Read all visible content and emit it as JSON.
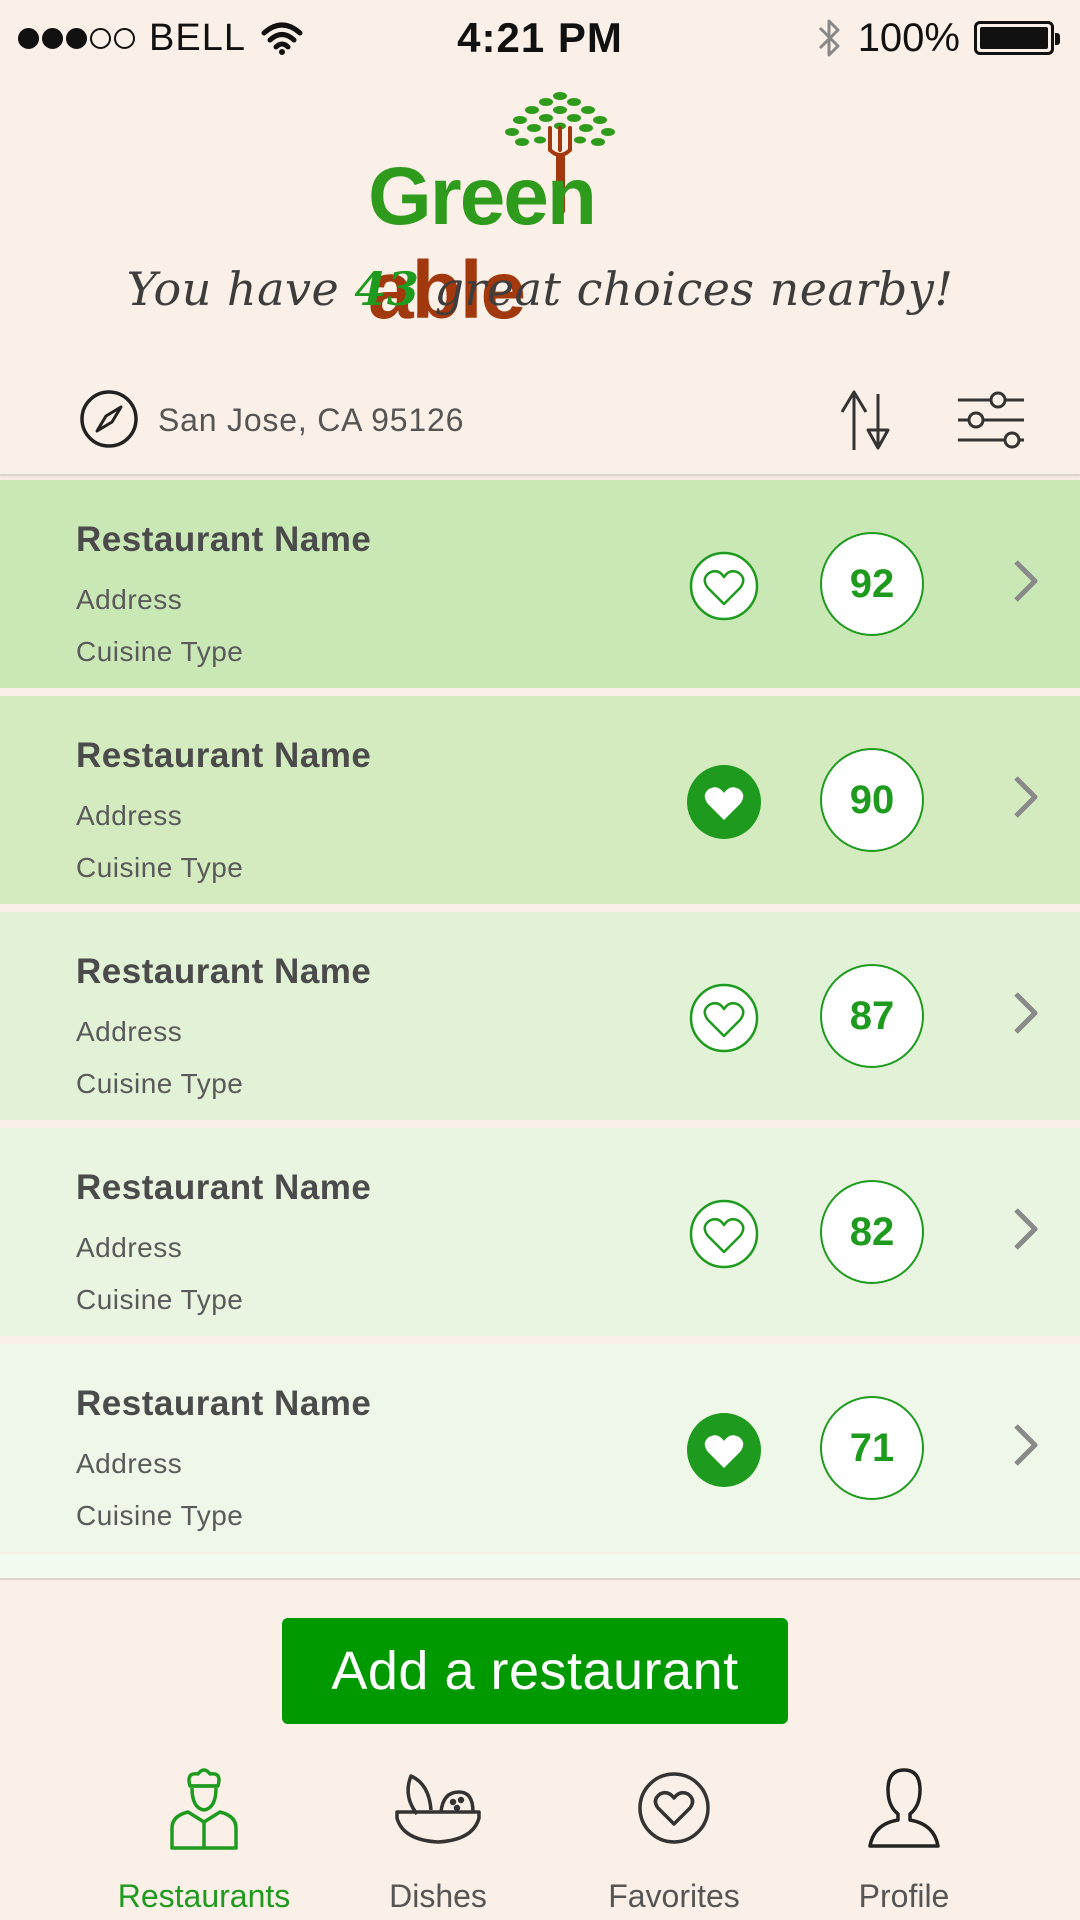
{
  "status_bar": {
    "carrier": "BELL",
    "time": "4:21 PM",
    "battery": "100%",
    "signal_bars": 3
  },
  "header": {
    "logo_part1": "Green",
    "logo_part2": "able",
    "tagline_prefix": "You have ",
    "tagline_count": "43",
    "tagline_suffix": " great choices nearby!"
  },
  "location": {
    "text": "San Jose, CA  95126"
  },
  "restaurants": [
    {
      "name": "Restaurant Name",
      "address": "Address",
      "cuisine": "Cuisine Type",
      "score": "92",
      "favorite": false,
      "bg": "#c9e8b6"
    },
    {
      "name": "Restaurant Name",
      "address": "Address",
      "cuisine": "Cuisine Type",
      "score": "90",
      "favorite": true,
      "bg": "#d3ebbf"
    },
    {
      "name": "Restaurant Name",
      "address": "Address",
      "cuisine": "Cuisine Type",
      "score": "87",
      "favorite": false,
      "bg": "#e2f2d6"
    },
    {
      "name": "Restaurant Name",
      "address": "Address",
      "cuisine": "Cuisine Type",
      "score": "82",
      "favorite": false,
      "bg": "#e9f5e1"
    },
    {
      "name": "Restaurant Name",
      "address": "Address",
      "cuisine": "Cuisine Type",
      "score": "71",
      "favorite": true,
      "bg": "#eef7e8"
    }
  ],
  "add_button": {
    "label": "Add a restaurant"
  },
  "tabs": [
    {
      "label": "Restaurants",
      "icon": "chef-icon",
      "active": true
    },
    {
      "label": "Dishes",
      "icon": "bowl-icon",
      "active": false
    },
    {
      "label": "Favorites",
      "icon": "heart-circle-icon",
      "active": false
    },
    {
      "label": "Profile",
      "icon": "person-icon",
      "active": false
    }
  ],
  "colors": {
    "accent": "#1e9b1e",
    "button": "#009a00",
    "logo_green": "#2f9b1c",
    "logo_brown": "#a2380d",
    "background": "#fbf0e7"
  }
}
